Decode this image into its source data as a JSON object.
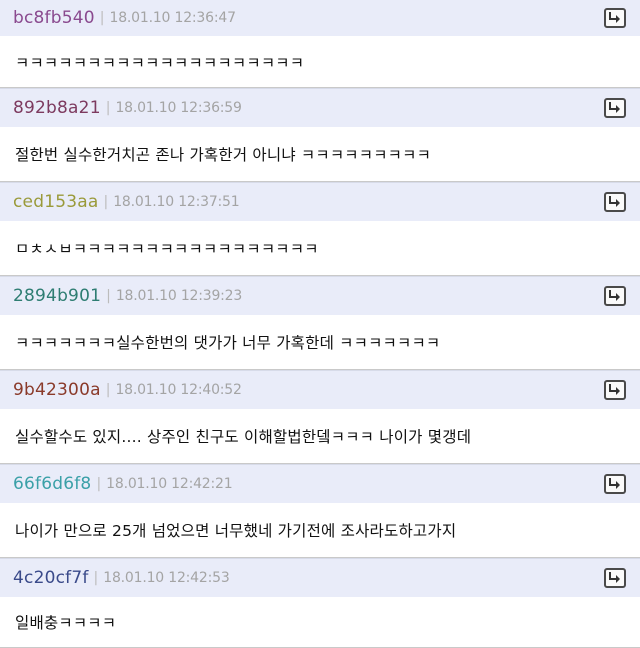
{
  "comments": [
    {
      "author": "bc8fb540",
      "author_color": "#8a4a8f",
      "time": "18.01.10 12:36:47",
      "text": "ㅋㅋㅋㅋㅋㅋㅋㅋㅋㅋㅋㅋㅋㅋㅋㅋㅋㅋㅋㅋ"
    },
    {
      "author": "892b8a21",
      "author_color": "#7d3a5f",
      "time": "18.01.10 12:36:59",
      "text": "절한번 실수한거치곤 존나 가혹한거 아니냐 ㅋㅋㅋㅋㅋㅋㅋㅋㅋ"
    },
    {
      "author": "ced153aa",
      "author_color": "#9a9a3a",
      "time": "18.01.10 12:37:51",
      "text": "ㅁㅊㅅㅂㅋㅋㅋㅋㅋㅋㅋㅋㅋㅋㅋㅋㅋㅋㅋㅋㅋ"
    },
    {
      "author": "2894b901",
      "author_color": "#2e7d72",
      "time": "18.01.10 12:39:23",
      "text": "ㅋㅋㅋㅋㅋㅋㅋ실수한번의 댓가가 너무 가혹한데 ㅋㅋㅋㅋㅋㅋㅋ"
    },
    {
      "author": "9b42300a",
      "author_color": "#8a3a2a",
      "time": "18.01.10 12:40:52",
      "text": "실수할수도 있지.... 상주인 친구도 이해할법한뎈ㅋㅋㅋ 나이가 몇갱데"
    },
    {
      "author": "66f6d6f8",
      "author_color": "#3aa0a8",
      "time": "18.01.10 12:42:21",
      "text": "나이가 만으로 25개 넘었으면 너무했네 가기전에 조사라도하고가지"
    },
    {
      "author": "4c20cf7f",
      "author_color": "#3a4a8a",
      "time": "18.01.10 12:42:53",
      "text": "일배충ㅋㅋㅋㅋ"
    }
  ],
  "reply_icon": "reply-arrow-icon"
}
